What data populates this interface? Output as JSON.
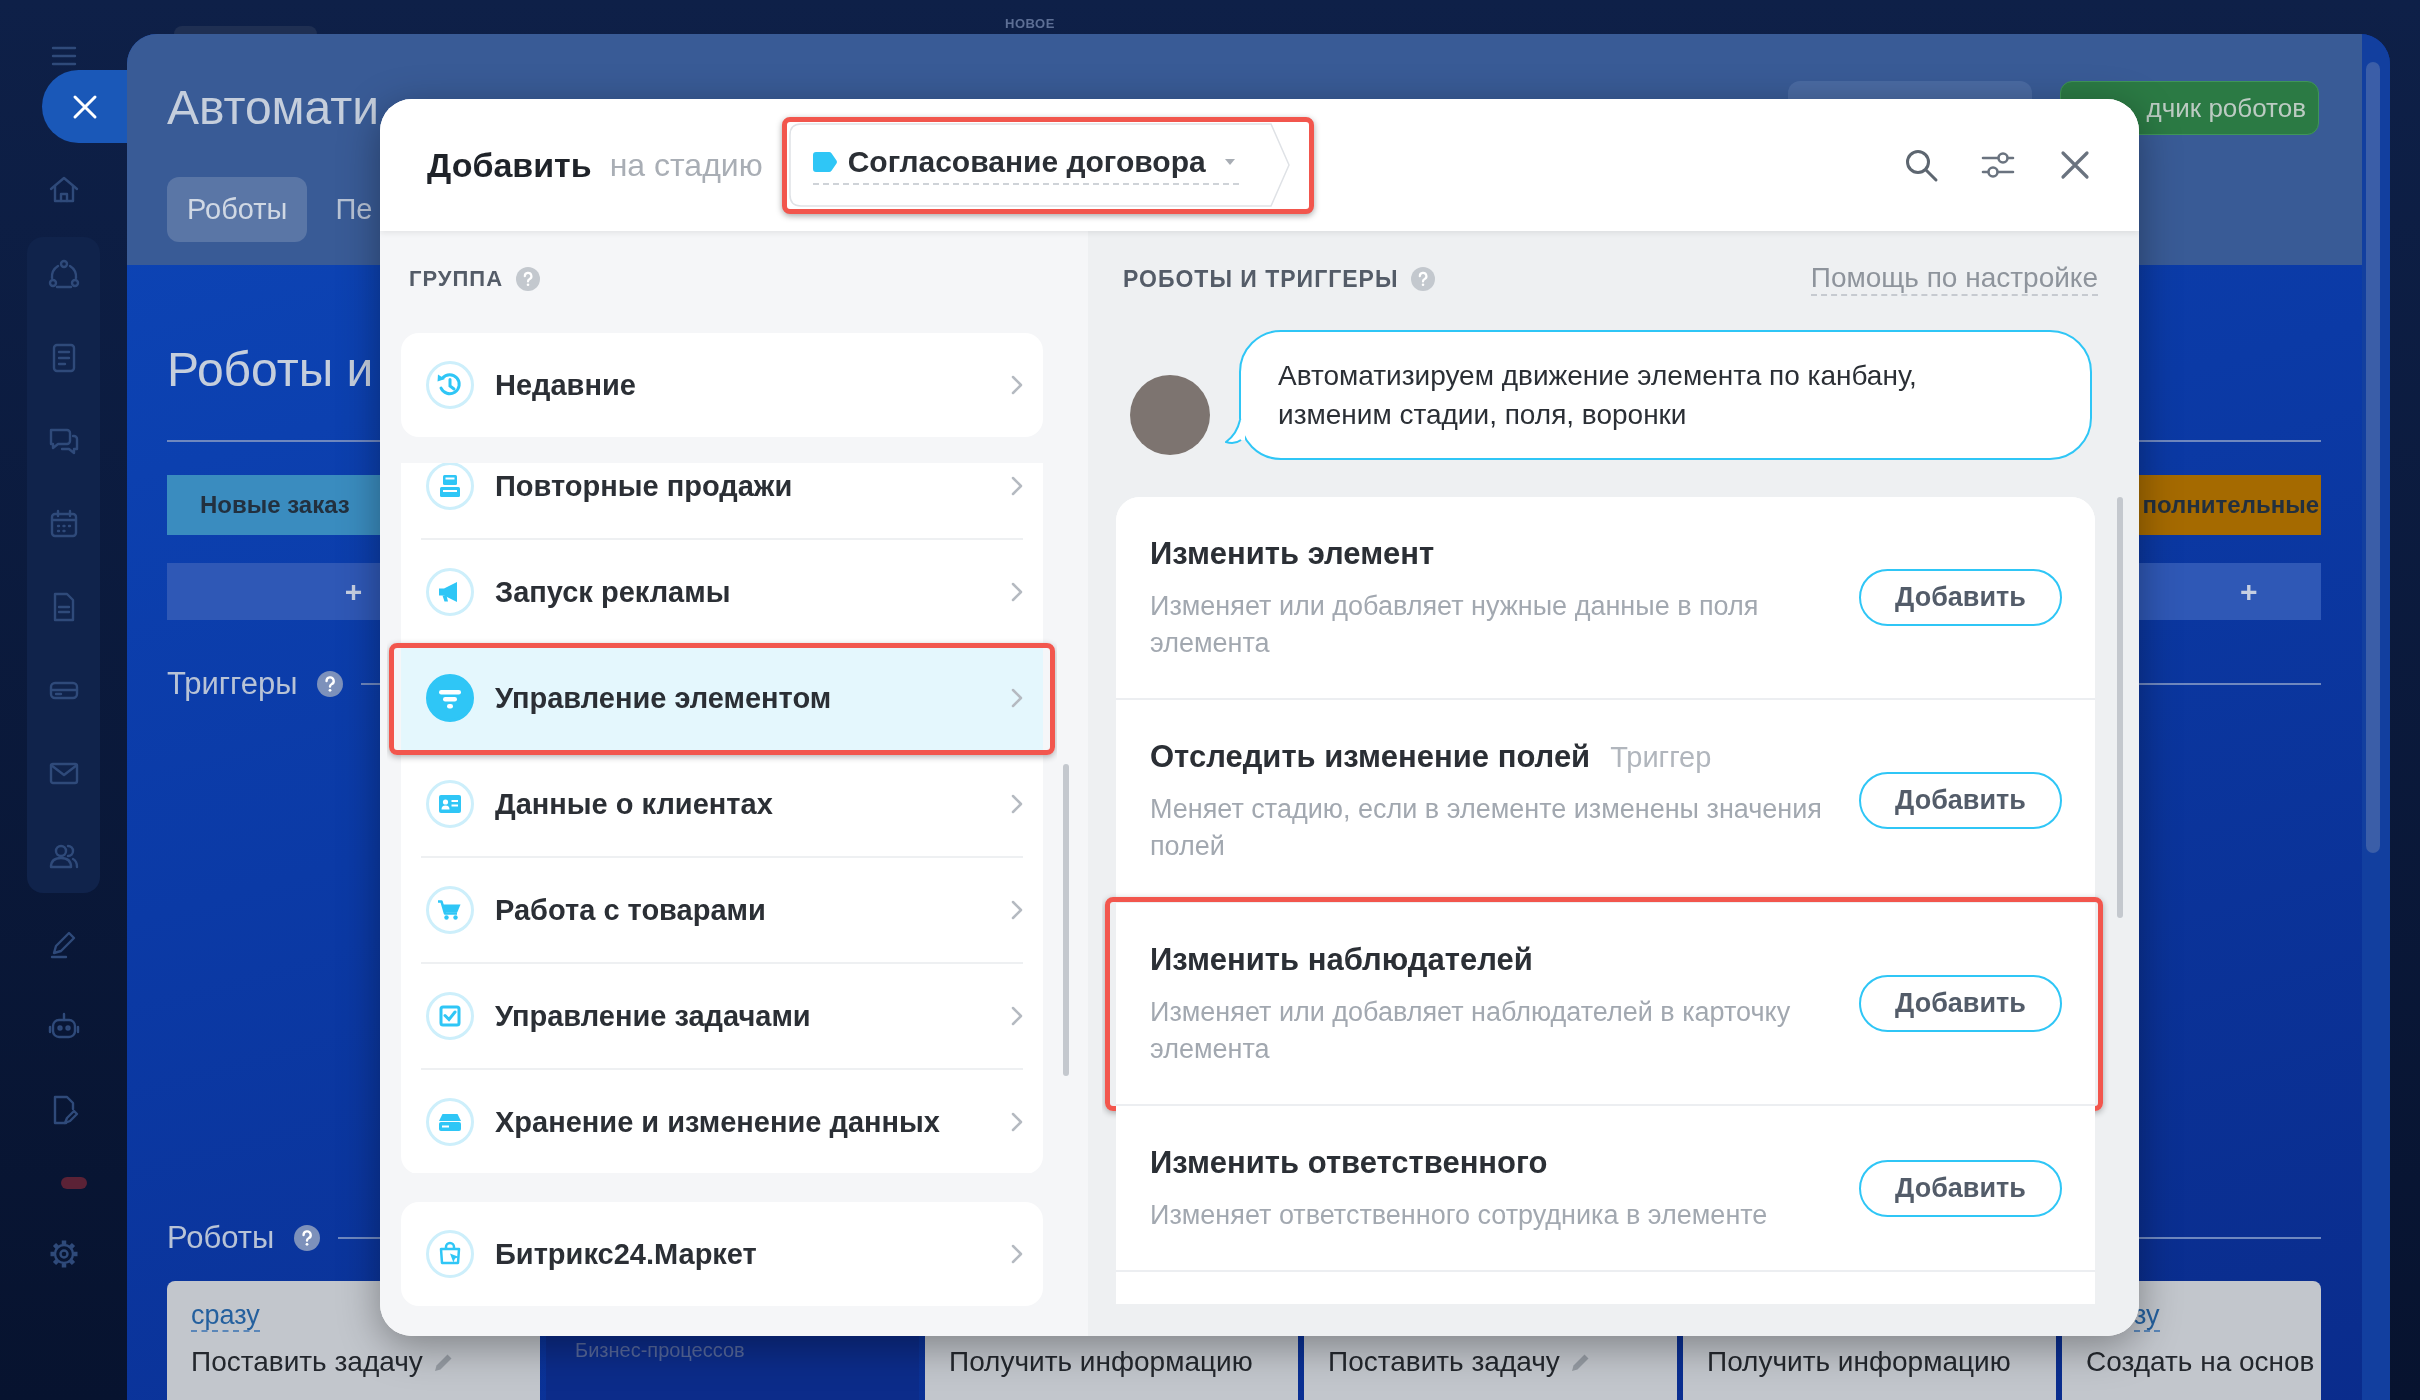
{
  "page": {
    "badge": "НОВОЕ",
    "title": "Автомати",
    "tabs": [
      {
        "label": "Роботы",
        "selected": true
      },
      {
        "label": "Пе",
        "selected": false
      }
    ],
    "header_button": "дчик роботов",
    "heading": "Роботы и",
    "stages": [
      {
        "name": "Новые заказ",
        "color": "#3a8cbf",
        "add": "+"
      },
      {
        "name": "полнительные",
        "color": "#a56a00",
        "add": "+"
      }
    ],
    "triggers_label": "Триггеры",
    "robots_label": "Роботы",
    "robot_cards": [
      {
        "kind": "with_pencil",
        "condition": "сразу",
        "name": "Поставить задачу"
      },
      {
        "kind": "placeholder",
        "name": "Бизнес-процессов"
      },
      {
        "kind": "plain",
        "name": "Получить информацию"
      },
      {
        "kind": "with_pencil",
        "name": "Поставить задачу"
      },
      {
        "kind": "plain",
        "name": "Получить информацию"
      },
      {
        "kind": "plain",
        "condition": "зу",
        "name": "Создать на основ"
      }
    ]
  },
  "modal": {
    "title": "Добавить",
    "stage_label": "на стадию",
    "stage": {
      "name": "Согласование договора",
      "color": "#2fc6f6",
      "highlighted": true
    },
    "groups": {
      "heading": "ГРУППА",
      "first_item": {
        "label": "Недавние",
        "selected": false,
        "highlighted": false
      },
      "items": [
        {
          "label": "Повторные продажи",
          "selected": false,
          "highlighted": false
        },
        {
          "label": "Запуск рекламы",
          "selected": false,
          "highlighted": false
        },
        {
          "label": "Управление элементом",
          "selected": true,
          "highlighted": true
        },
        {
          "label": "Данные о клиентах",
          "selected": false,
          "highlighted": false
        },
        {
          "label": "Работа с товарами",
          "selected": false,
          "highlighted": false
        },
        {
          "label": "Управление задачами",
          "selected": false,
          "highlighted": false
        },
        {
          "label": "Хранение и изменение данных",
          "selected": false,
          "highlighted": false
        }
      ],
      "last_item": {
        "label": "Битрикс24.Маркет",
        "selected": false,
        "highlighted": false
      }
    },
    "robots": {
      "heading": "РОБОТЫ И ТРИГГЕРЫ",
      "help_link": "Помощь по настройке",
      "hint": "Автоматизируем движение элемента по канбану, изменим стадии, поля, воронки",
      "items": [
        {
          "title": "Изменить элемент",
          "description": "Изменяет или добавляет нужные данные в поля элемента",
          "button": "Добавить",
          "highlighted": false
        },
        {
          "title": "Отследить изменение полей",
          "tag": "Триггер",
          "description": "Меняет стадию, если в элементе изменены значения полей",
          "button": "Добавить",
          "highlighted": false
        },
        {
          "title": "Изменить наблюдателей",
          "description": "Изменяет или добавляет наблюдателей в карточку элемента",
          "button": "Добавить",
          "highlighted": true
        },
        {
          "title": "Изменить ответственного",
          "description": "Изменяет ответственного сотрудника в элементе",
          "button": "Добавить",
          "highlighted": false
        }
      ]
    }
  }
}
